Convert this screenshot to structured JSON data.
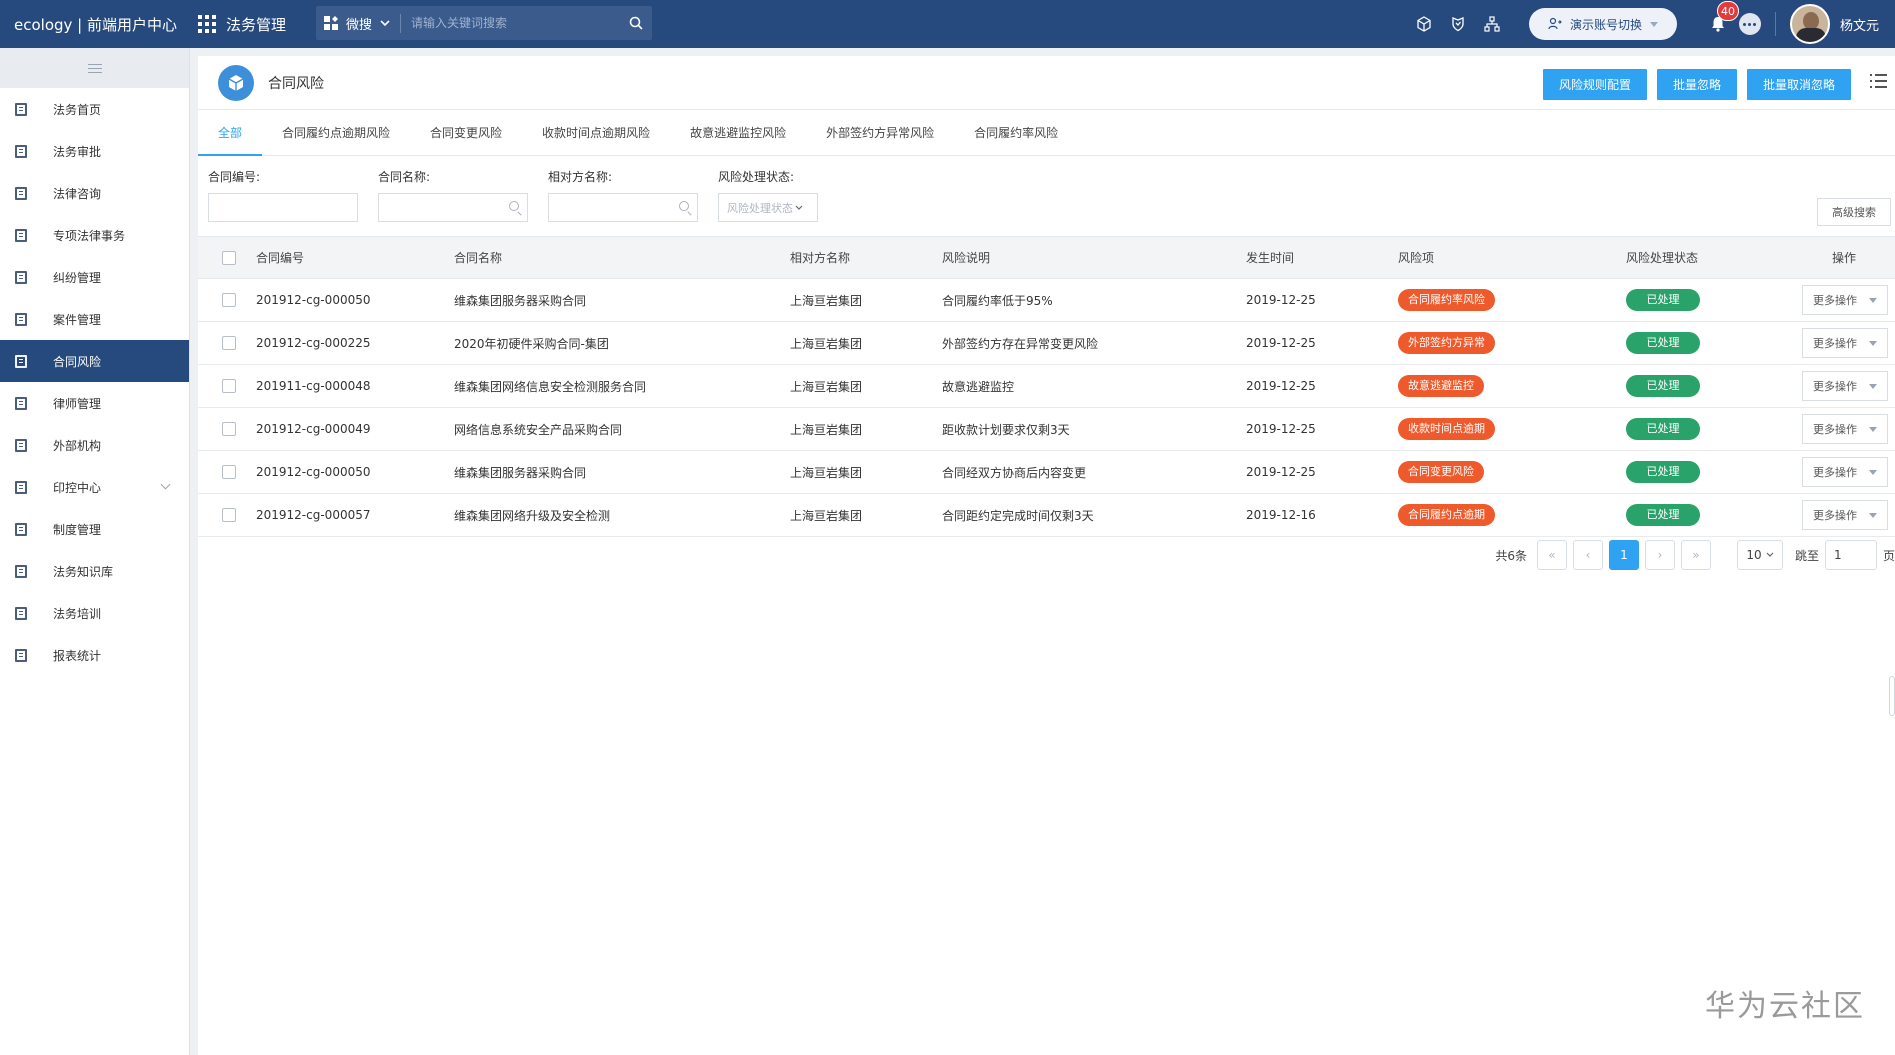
{
  "topbar": {
    "brand": "ecology | 前端用户中心",
    "module": "法务管理",
    "search_scope": "微搜",
    "search_placeholder": "请输入关键词搜索",
    "switch_account": "演示账号切换",
    "notification_count": "40",
    "username": "杨文元"
  },
  "sidebar": {
    "items": [
      {
        "label": "法务首页"
      },
      {
        "label": "法务审批"
      },
      {
        "label": "法律咨询"
      },
      {
        "label": "专项法律事务"
      },
      {
        "label": "纠纷管理"
      },
      {
        "label": "案件管理"
      },
      {
        "label": "合同风险"
      },
      {
        "label": "律师管理"
      },
      {
        "label": "外部机构"
      },
      {
        "label": "印控中心"
      },
      {
        "label": "制度管理"
      },
      {
        "label": "法务知识库"
      },
      {
        "label": "法务培训"
      },
      {
        "label": "报表统计"
      }
    ],
    "active_index": 6
  },
  "page": {
    "title": "合同风险",
    "actions": {
      "config": "风险规则配置",
      "ignore": "批量忽略",
      "unignore": "批量取消忽略"
    }
  },
  "tabs": [
    {
      "label": "全部"
    },
    {
      "label": "合同履约点逾期风险"
    },
    {
      "label": "合同变更风险"
    },
    {
      "label": "收款时间点逾期风险"
    },
    {
      "label": "故意逃避监控风险"
    },
    {
      "label": "外部签约方异常风险"
    },
    {
      "label": "合同履约率风险"
    }
  ],
  "filters": {
    "contract_no": "合同编号:",
    "contract_name": "合同名称:",
    "counterparty": "相对方名称:",
    "status_label": "风险处理状态:",
    "status_placeholder": "风险处理状态",
    "advanced": "高级搜索"
  },
  "table": {
    "columns": [
      "合同编号",
      "合同名称",
      "相对方名称",
      "风险说明",
      "发生时间",
      "风险项",
      "风险处理状态",
      "操作"
    ],
    "rows": [
      {
        "no": "201912-cg-000050",
        "name": "维森集团服务器采购合同",
        "party": "上海亘岩集团",
        "desc": "合同履约率低于95%",
        "date": "2019-12-25",
        "risk": "合同履约率风险",
        "status": "已处理",
        "op": "更多操作"
      },
      {
        "no": "201912-cg-000225",
        "name": "2020年初硬件采购合同-集团",
        "party": "上海亘岩集团",
        "desc": "外部签约方存在异常变更风险",
        "date": "2019-12-25",
        "risk": "外部签约方异常",
        "status": "已处理",
        "op": "更多操作"
      },
      {
        "no": "201911-cg-000048",
        "name": "维森集团网络信息安全检测服务合同",
        "party": "上海亘岩集团",
        "desc": "故意逃避监控",
        "date": "2019-12-25",
        "risk": "故意逃避监控",
        "status": "已处理",
        "op": "更多操作"
      },
      {
        "no": "201912-cg-000049",
        "name": "网络信息系统安全产品采购合同",
        "party": "上海亘岩集团",
        "desc": "距收款计划要求仅剩3天",
        "date": "2019-12-25",
        "risk": "收款时间点逾期",
        "status": "已处理",
        "op": "更多操作"
      },
      {
        "no": "201912-cg-000050",
        "name": "维森集团服务器采购合同",
        "party": "上海亘岩集团",
        "desc": "合同经双方协商后内容变更",
        "date": "2019-12-25",
        "risk": "合同变更风险",
        "status": "已处理",
        "op": "更多操作"
      },
      {
        "no": "201912-cg-000057",
        "name": "维森集团网络升级及安全检测",
        "party": "上海亘岩集团",
        "desc": "合同距约定完成时间仅剩3天",
        "date": "2019-12-16",
        "risk": "合同履约点逾期",
        "status": "已处理",
        "op": "更多操作"
      }
    ]
  },
  "pager": {
    "total": "共6条",
    "current": "1",
    "page_size": "10",
    "jump_label": "跳至",
    "jump_value": "1",
    "page_unit": "页"
  },
  "watermark": "华为云社区",
  "colors": {
    "topbar": "#274a7e",
    "primary": "#2fa3f2",
    "risk_tag": "#ee5a2b",
    "status_tag": "#2aa36a"
  }
}
